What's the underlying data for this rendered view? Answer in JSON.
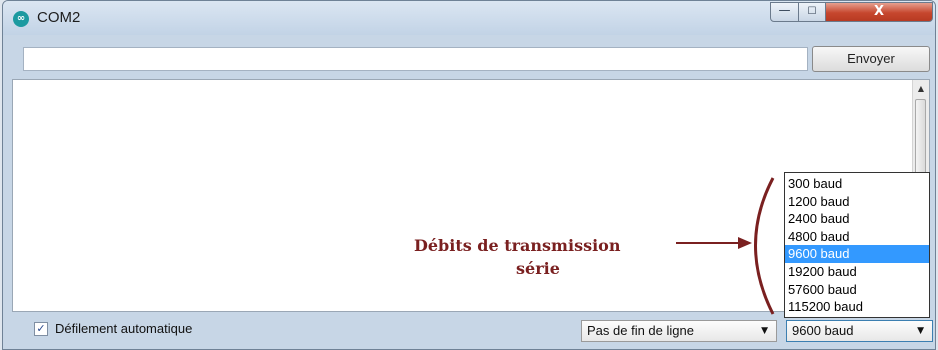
{
  "window": {
    "title": "COM2",
    "app_icon_glyph": "∞",
    "controls": {
      "minimize_glyph": "—",
      "maximize_glyph": "☐",
      "close_glyph": "X"
    }
  },
  "input": {
    "value": "",
    "send_label": "Envoyer"
  },
  "scrollbar": {
    "up_glyph": "▲",
    "grip_glyph": "≡"
  },
  "annotation": {
    "line1": "Débits de transmission",
    "line2": "série",
    "color": "#7a2020"
  },
  "baud_dropdown": {
    "options": [
      "300 baud",
      "1200 baud",
      "2400 baud",
      "4800 baud",
      "9600 baud",
      "19200 baud",
      "57600 baud",
      "115200 baud"
    ],
    "selected_index": 4,
    "selected_label": "9600 baud",
    "highlight_color": "#3399ff"
  },
  "bottom": {
    "autoscroll_checked": true,
    "autoscroll_check_glyph": "✓",
    "autoscroll_label": "Défilement automatique",
    "line_ending": "Pas de fin de ligne",
    "arrow_glyph": "▼"
  }
}
